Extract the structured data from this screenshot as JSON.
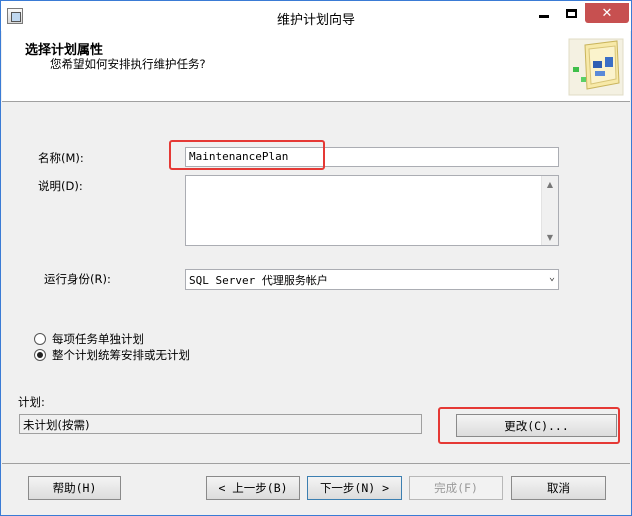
{
  "window": {
    "title": "维护计划向导"
  },
  "header": {
    "title": "选择计划属性",
    "subtitle": "您希望如何安排执行维护任务?"
  },
  "form": {
    "name_label": "名称(M):",
    "name_value": "MaintenancePlan",
    "description_label": "说明(D):",
    "description_value": "",
    "run_as_label": "运行身份(R):",
    "run_as_value": "SQL Server 代理服务帐户"
  },
  "schedule_options": [
    {
      "label": "每项任务单独计划",
      "selected": false
    },
    {
      "label": "整个计划统筹安排或无计划",
      "selected": true
    }
  ],
  "schedule": {
    "label": "计划:",
    "value": "未计划(按需)",
    "change_button": "更改(C)..."
  },
  "footer": {
    "help": "帮助(H)",
    "back": "< 上一步(B)",
    "next": "下一步(N) >",
    "finish": "完成(F)",
    "cancel": "取消"
  },
  "icons": {
    "window": "app-window-icon",
    "minimize": "minimize-icon",
    "maximize": "maximize-icon",
    "close": "close-icon",
    "wizard": "wizard-illustration-icon"
  },
  "colors": {
    "highlight": "#e53935",
    "close_button": "#c75050",
    "window_border": "#3a7bd5"
  }
}
